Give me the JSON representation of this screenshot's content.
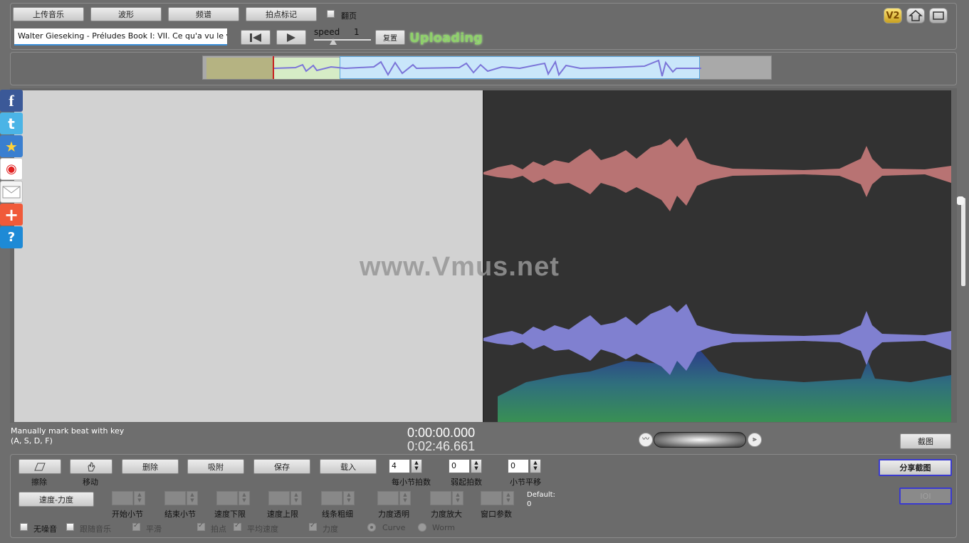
{
  "toolbar": {
    "upload_music": "上传音乐",
    "waveform": "波形",
    "score": "频谱",
    "beat_mark": "拍点标记",
    "page_turn": "翻页"
  },
  "track": {
    "title": "Walter Gieseking - Préludes Book I:  VII. Ce qu'a vu le vent d'"
  },
  "playback": {
    "speed_label": "speed",
    "speed_value": "1",
    "reset": "复置",
    "status": "Uploading"
  },
  "header_icons": {
    "v2": "V2"
  },
  "watermark": "www.Vmus.net",
  "hint": {
    "line1": "Manually mark beat with key",
    "line2": "(A, S, D, F)"
  },
  "time": {
    "current": "0:00:00.000",
    "total": "0:02:46.661"
  },
  "screenshot_button": "截图",
  "share_screenshot_button": "分享截图",
  "ioi_button": "IOI",
  "tools": {
    "erase": "擦除",
    "move": "移动",
    "delete": "删除",
    "snap": "吸附",
    "save": "保存",
    "load": "载入"
  },
  "meter": {
    "beats_per_bar": {
      "label": "每小节拍数",
      "value": "4"
    },
    "pickup_beats": {
      "label": "弱起拍数",
      "value": "0"
    },
    "bar_offset": {
      "label": "小节平移",
      "value": "0"
    }
  },
  "tempo_dynamics": "速度-力度",
  "params": [
    "开始小节",
    "结束小节",
    "速度下限",
    "速度上限",
    "线条粗细",
    "力度透明",
    "力度放大",
    "窗口参数"
  ],
  "default_label": "Default:",
  "default_value": "0",
  "options": {
    "no_noise": "无噪音",
    "follow_music": "跟随音乐",
    "smooth": "平滑",
    "beat": "拍点",
    "avg_speed": "平均速度",
    "dynamics": "力度",
    "curve": "Curve",
    "worm": "Worm"
  },
  "colors": {
    "waveform_top": "#b87373",
    "waveform_bottom": "#8080d0",
    "status_green": "#8fd16a",
    "accent_border": "#3a3ad0"
  }
}
